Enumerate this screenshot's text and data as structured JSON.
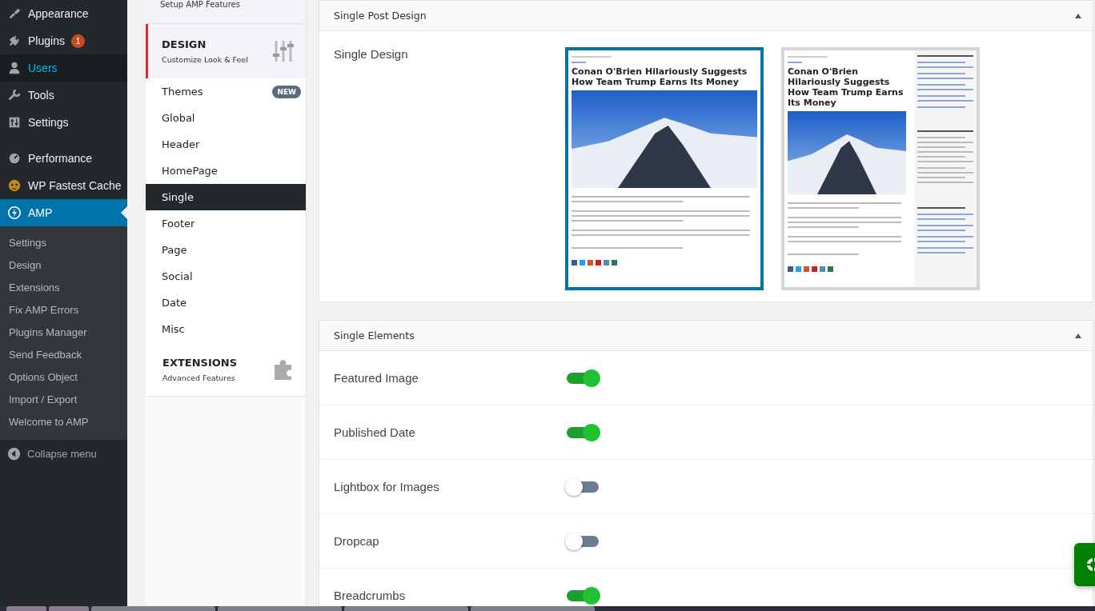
{
  "admin_menu": {
    "items": [
      {
        "label": "Appearance",
        "selected": false,
        "hovered": false
      },
      {
        "label": "Plugins",
        "badge": "1",
        "selected": false,
        "hovered": false
      },
      {
        "label": "Users",
        "selected": false,
        "hovered": true
      },
      {
        "label": "Tools",
        "selected": false,
        "hovered": false
      },
      {
        "label": "Settings",
        "selected": false,
        "hovered": false
      },
      {
        "label": "Performance",
        "selected": false,
        "hovered": false
      },
      {
        "label": "WP Fastest Cache",
        "selected": false,
        "hovered": false
      },
      {
        "label": "AMP",
        "selected": true,
        "hovered": false
      }
    ],
    "submenu": [
      "Settings",
      "Design",
      "Extensions",
      "Fix AMP Errors",
      "Plugins Manager",
      "Send Feedback",
      "Options Object",
      "Import / Export",
      "Welcome to AMP"
    ],
    "collapse": "Collapse menu"
  },
  "settings_nav": {
    "top_item": {
      "subtitle": "Setup AMP Features"
    },
    "sections": [
      {
        "title": "DESIGN",
        "subtitle": "Customize Look & Feel",
        "selected": true,
        "items": [
          {
            "label": "Themes",
            "badge": "NEW",
            "selected": false
          },
          {
            "label": "Global",
            "selected": false
          },
          {
            "label": "Header",
            "selected": false
          },
          {
            "label": "HomePage",
            "selected": false
          },
          {
            "label": "Single",
            "selected": true
          },
          {
            "label": "Footer",
            "selected": false
          },
          {
            "label": "Page",
            "selected": false
          },
          {
            "label": "Social",
            "selected": false
          },
          {
            "label": "Date",
            "selected": false
          },
          {
            "label": "Misc",
            "selected": false
          }
        ]
      },
      {
        "title": "EXTENSIONS",
        "subtitle": "Advanced Features",
        "selected": false
      }
    ]
  },
  "single_post_design": {
    "title": "Single Post Design",
    "label": "Single Design",
    "layouts": [
      {
        "kind": "full",
        "headline": "Conan O'Brien Hilariously Suggests How Team Trump Earns Its Money",
        "selected": true
      },
      {
        "kind": "sidebar",
        "headline": "Conan O'Brien Hilariously Suggests How Team Trump Earns Its Money",
        "selected": false
      }
    ]
  },
  "single_elements": {
    "title": "Single Elements",
    "options": [
      {
        "label": "Featured Image",
        "on": true
      },
      {
        "label": "Published Date",
        "on": true
      },
      {
        "label": "Lightbox for Images",
        "on": false
      },
      {
        "label": "Dropcap",
        "on": false
      },
      {
        "label": "Breadcrumbs",
        "on": true
      }
    ]
  }
}
